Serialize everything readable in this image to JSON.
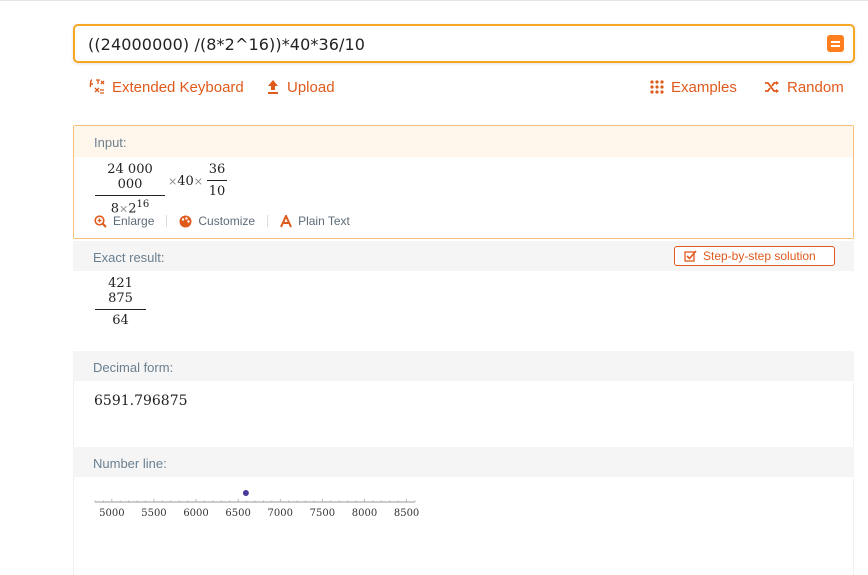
{
  "query": {
    "value": "((24000000) /(8*2^16))*40*36/10",
    "submit_icon": "equals-icon",
    "accent": "#ff7f20"
  },
  "toolbar": {
    "extended_keyboard": "Extended Keyboard",
    "upload": "Upload",
    "examples": "Examples",
    "random": "Random",
    "color": "#e05a1c"
  },
  "pods": {
    "input": {
      "title": "Input:",
      "numerator": "24 000 000",
      "denominator_base": "8",
      "denominator_power_base": "2",
      "denominator_exponent": "16",
      "factor1": "40",
      "fraction2_numerator": "36",
      "fraction2_denominator": "10",
      "times": "×",
      "actions": {
        "enlarge": "Enlarge",
        "customize": "Customize",
        "plain_text": "Plain Text"
      }
    },
    "exact": {
      "title": "Exact result:",
      "step_button": "Step-by-step solution",
      "numerator": "421 875",
      "denominator": "64"
    },
    "decimal": {
      "title": "Decimal form:",
      "value": "6591.796875"
    },
    "number_line": {
      "title": "Number line:",
      "ticks": [
        "5000",
        "5500",
        "6000",
        "6500",
        "7000",
        "7500",
        "8000",
        "8500"
      ],
      "point": 6591.796875,
      "min": 4800,
      "max": 8600,
      "point_color": "#4a3a9a"
    }
  }
}
